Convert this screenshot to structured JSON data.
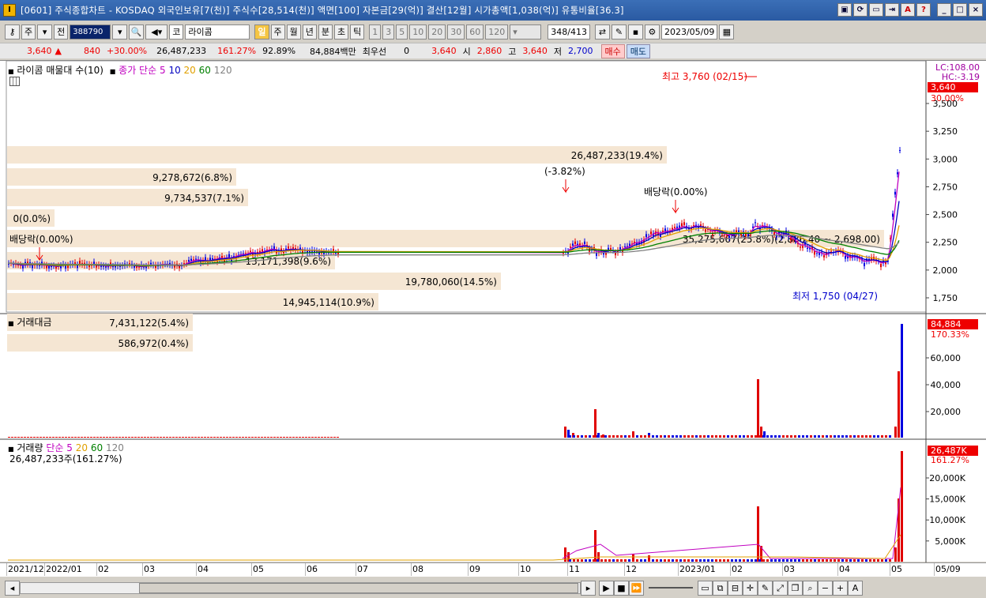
{
  "window": {
    "title": "[0601] 주식종합차트 - KOSDAQ 외국인보유[7(천)] 주식수[28,514(천)] 액면[100] 자본금[29(억)] 결산[12월] 시가총액[1,038(억)] 유통비율[36.3]",
    "buttons": [
      "▣",
      "⟳",
      "▭",
      "⇥",
      "A",
      "?",
      "_",
      "□",
      "×"
    ]
  },
  "toolbar": {
    "market": "주",
    "prev": "전",
    "code": "388790",
    "market_type": "코",
    "stock_name": "라이콤",
    "periods": [
      "일",
      "주",
      "월",
      "년",
      "분",
      "초",
      "틱"
    ],
    "active_period": "일",
    "intervals": [
      "1",
      "3",
      "5",
      "10",
      "20",
      "30",
      "60",
      "120"
    ],
    "bar_count": "348",
    "bar_total": "/413",
    "date": "2023/05/09"
  },
  "quote": {
    "price": "3,640",
    "change": "840",
    "change_pct": "+30.00%",
    "volume": "26,487,233",
    "vol_ratio": "161.27%",
    "ratio2": "92.89%",
    "amount": "84,884백만",
    "best_label": "최우선",
    "best_val": "0",
    "best_price": "3,640",
    "open_label": "시",
    "open": "2,860",
    "high_label": "고",
    "high": "3,640",
    "low_label": "저",
    "low": "2,700",
    "buy": "매수",
    "sell": "매도"
  },
  "price_panel": {
    "legend_name": "라이콤 매물대 수(10)",
    "legend_ma": "종가 단순",
    "ma": [
      "5",
      "10",
      "20",
      "60",
      "120"
    ],
    "lc": "LC:108.00",
    "hc": "HC:-3.19",
    "cur_price": "3,640",
    "cur_pct": "30.00%",
    "max_label": "최고 3,760 (02/15)",
    "min_label": "최저 1,750 (04/27)",
    "annotations": [
      "(-3.82%)",
      "배당락(0.00%)",
      "배당락(0.00%)"
    ],
    "y_ticks": [
      "3,500",
      "3,250",
      "3,000",
      "2,750",
      "2,500",
      "2,250",
      "2,000",
      "1,750"
    ],
    "volume_profile": [
      {
        "label": "26,487,233(19.4%)"
      },
      {
        "label": "9,278,672(6.8%)"
      },
      {
        "label": "9,734,537(7.1%)"
      },
      {
        "label": "0(0.0%)"
      },
      {
        "label": "35,275,667(25.8%)(2,886.40 ~ 2,698.00)"
      },
      {
        "label": "13,171,398(9.6%)"
      },
      {
        "label": "19,780,060(14.5%)"
      },
      {
        "label": "14,945,114(10.9%)"
      },
      {
        "label": "7,431,122(5.4%)"
      },
      {
        "label": "586,972(0.4%)"
      }
    ]
  },
  "amount_panel": {
    "legend": "거래대금",
    "cur": "84,884",
    "pct": "170.33%",
    "y_ticks": [
      "60,000",
      "40,000",
      "20,000"
    ]
  },
  "volume_panel": {
    "legend": "거래량",
    "legend_ma": "단순",
    "ma": [
      "5",
      "20",
      "60",
      "120"
    ],
    "sub": "26,487,233주(161.27%)",
    "cur": "26,487K",
    "pct": "161.27%",
    "y_ticks": [
      "20,000K",
      "15,000K",
      "10,000K",
      "5,000K"
    ]
  },
  "xaxis": [
    "2021/12",
    "2022/01",
    "02",
    "03",
    "04",
    "05",
    "06",
    "07",
    "08",
    "09",
    "10",
    "11",
    "12",
    "2023/01",
    "02",
    "03",
    "04",
    "05",
    "05/09"
  ],
  "colors": {
    "up": "#e00000",
    "down": "#0000e0",
    "profile": "#f5e6d3",
    "ma5": "#c000c0",
    "ma10": "#0000c0",
    "ma20": "#e0a000",
    "ma60": "#008000",
    "ma120": "#808080"
  }
}
